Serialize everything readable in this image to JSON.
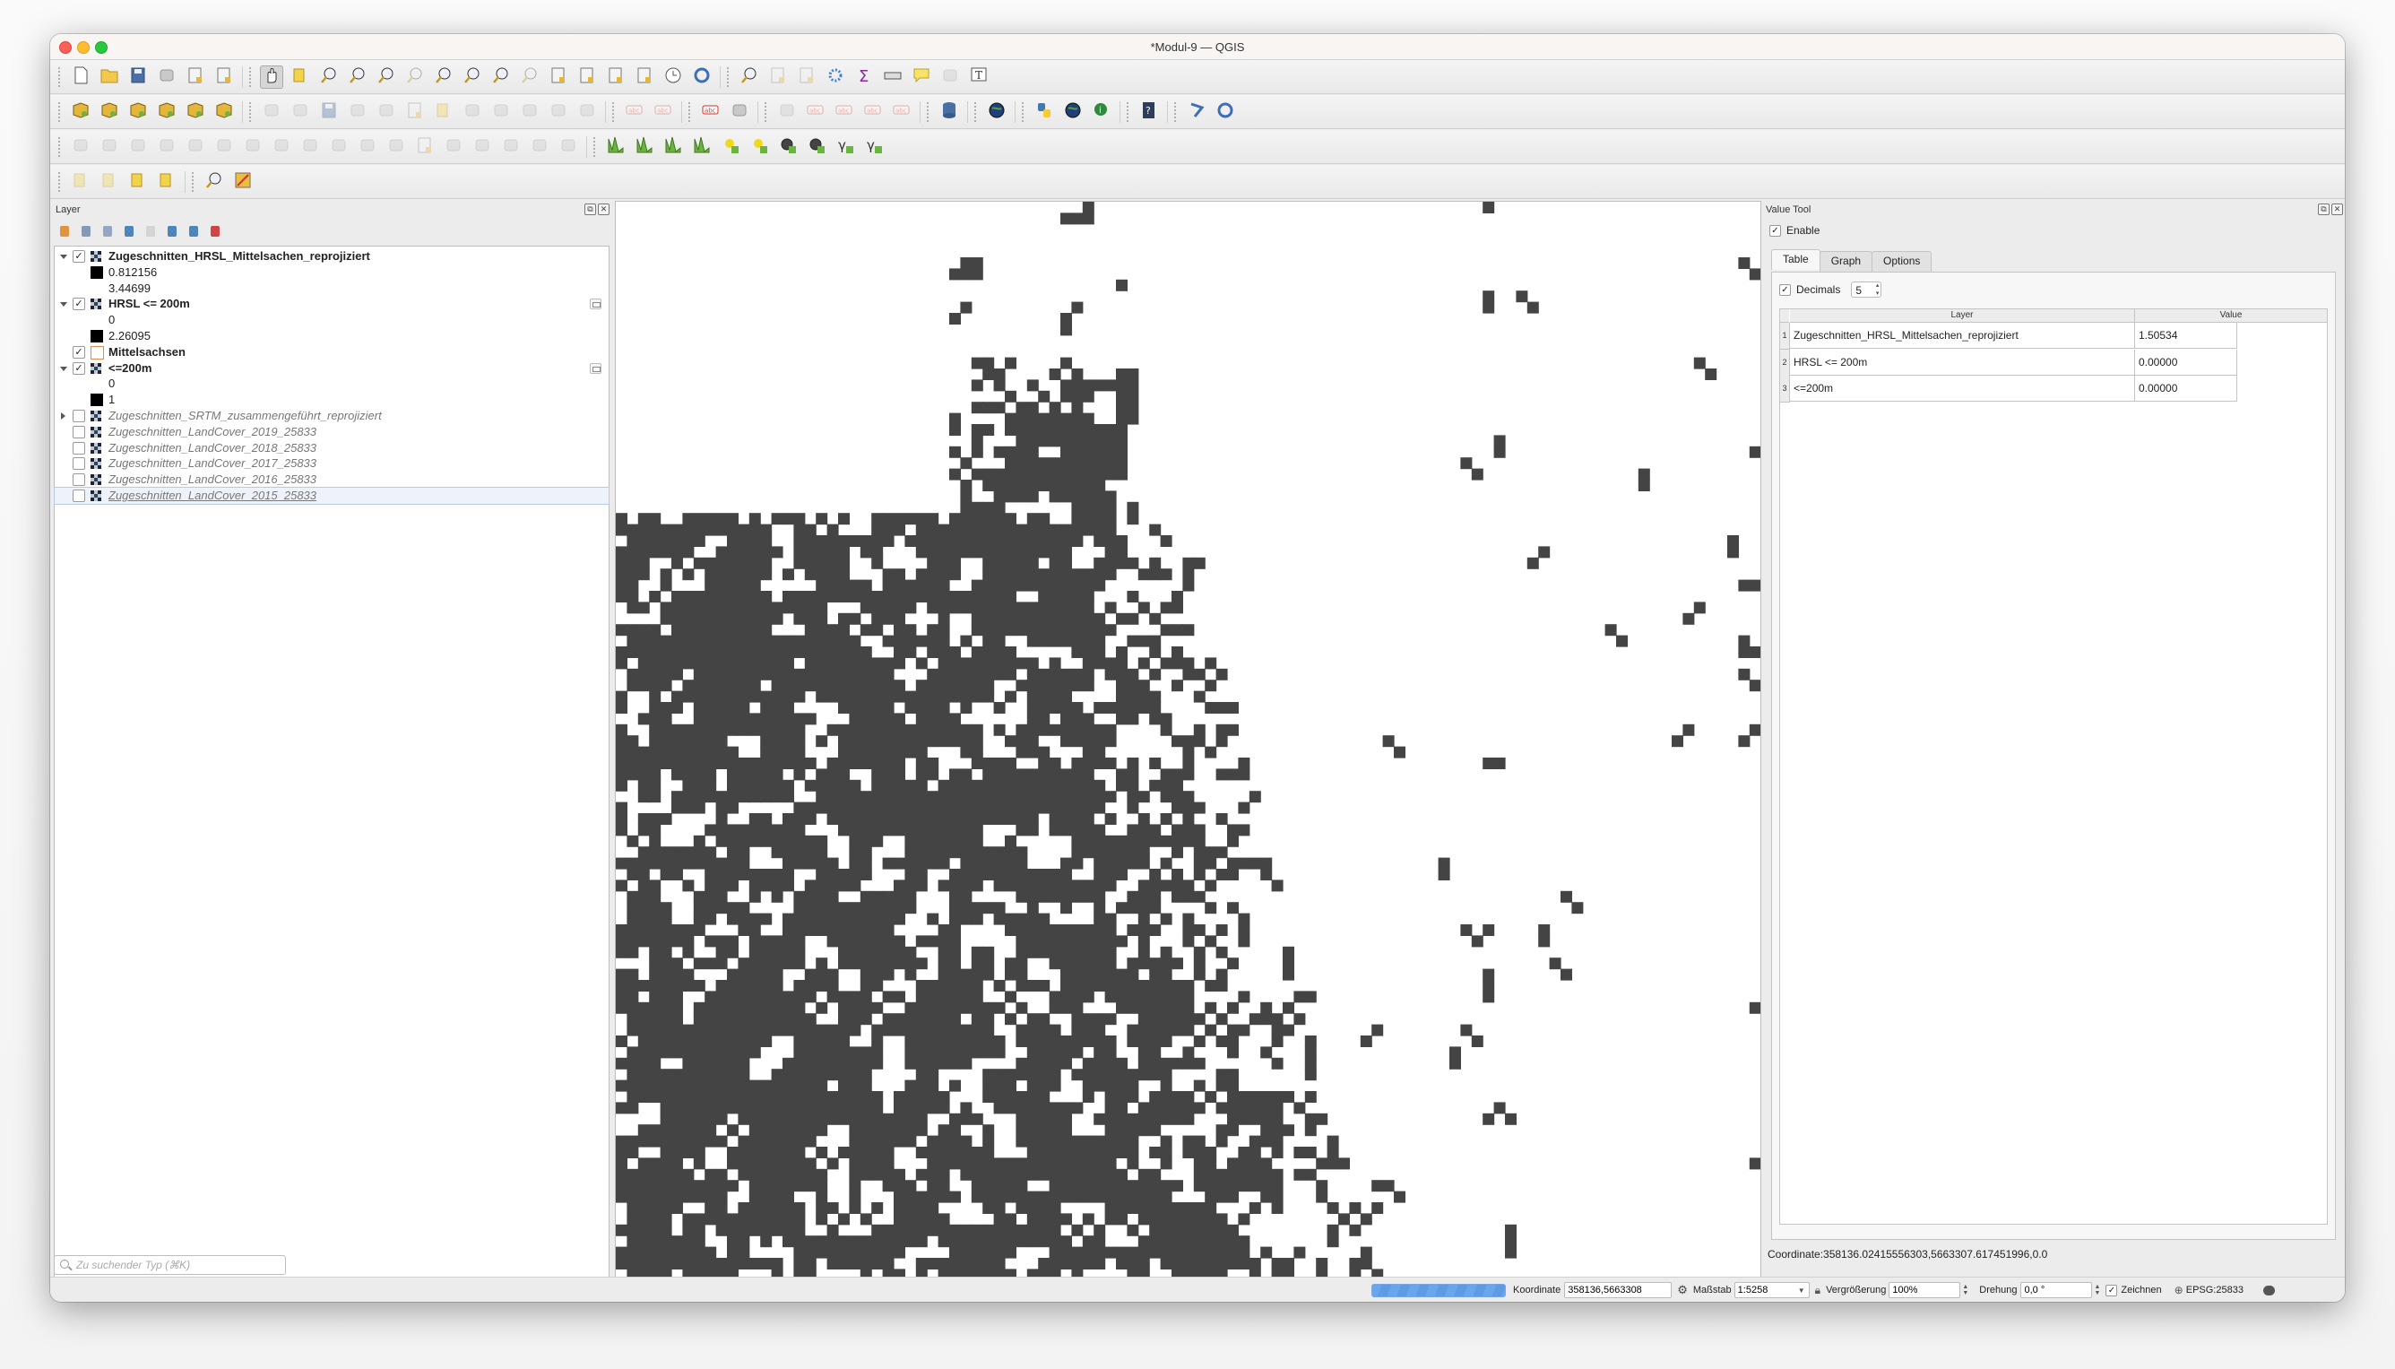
{
  "window": {
    "title": "*Modul-9 — QGIS"
  },
  "toolbars": {
    "row1": [
      "new-project-icon",
      "open-project-icon",
      "save-project-icon",
      "save-as-icon",
      "print-layout-icon",
      "style-manager-icon",
      "|",
      "pan-icon",
      "pan-to-selection-icon",
      "zoom-in-icon",
      "zoom-out-icon",
      "zoom-full-icon",
      "zoom-to-selection-icon",
      "zoom-to-layer-icon",
      "zoom-native-icon",
      "zoom-last-icon",
      "zoom-next-icon",
      "new-map-view-icon",
      "new-3d-view-icon",
      "new-bookmark-icon",
      "show-bookmarks-icon",
      "temporal-controller-icon",
      "refresh-icon",
      "|",
      "identify-icon",
      "open-attribute-table-icon",
      "statistics-icon",
      "toolbox-icon",
      "sum-icon",
      "measure-icon",
      "map-tips-icon",
      "annotation-icon",
      "text-annotation-icon"
    ],
    "row2": [
      "data-source-manager-icon",
      "new-geopackage-icon",
      "new-shapefile-icon",
      "new-spatialite-icon",
      "new-virtual-layer-icon",
      "new-temp-layer-icon",
      "|",
      "current-edits-icon",
      "toggle-editing-icon",
      "save-edits-icon",
      "add-feature-icon",
      "vertex-tool-icon",
      "modify-attributes-icon",
      "delete-selected-icon",
      "cut-icon",
      "copy-icon",
      "paste-icon",
      "undo-icon",
      "redo-icon",
      "|",
      "label-icon",
      "pin-labels-icon",
      "|",
      "layer-labeling-icon",
      "layer-diagram-icon",
      "|",
      "highlight-pinned-icon",
      "show-hide-labels-icon",
      "move-label-icon",
      "rotate-label-icon",
      "change-label-icon",
      "|",
      "db-manager-icon",
      "|",
      "metasearch-icon",
      "|",
      "python-console-icon",
      "globe-icon",
      "info-icon",
      "|",
      "help-icon",
      "|",
      "topology-checker-icon",
      "table-sync-icon"
    ],
    "row3": [
      "digitize-shape-icon",
      "measure-angle-icon",
      "add-ring-icon",
      "add-part-icon",
      "fill-ring-icon",
      "delete-ring-icon",
      "delete-part-icon",
      "reshape-icon",
      "offset-curve-icon",
      "split-features-icon",
      "split-parts-icon",
      "merge-features-icon",
      "merge-attributes-icon",
      "rotate-point-icon",
      "simplify-icon",
      "add-circular-icon",
      "trim-extend-icon",
      "reverse-line-icon",
      "|",
      "histogram-icon",
      "histogram-stretch-icon",
      "local-histogram-icon",
      "local-stretch-icon",
      "increase-brightness-icon",
      "decrease-brightness-icon",
      "increase-contrast-icon",
      "decrease-contrast-icon",
      "increase-gamma-icon",
      "decrease-gamma-icon"
    ],
    "row4": [
      "select-features-icon",
      "select-by-value-icon",
      "deselect-icon",
      "select-location-icon",
      "|",
      "locator-icon",
      "georeferencer-icon"
    ]
  },
  "layers_panel": {
    "title": "Layer",
    "tools": [
      "open-styling-icon",
      "add-group-icon",
      "manage-visibility-icon",
      "filter-legend-icon",
      "filter-expression-icon",
      "expand-all-icon",
      "collapse-all-icon",
      "remove-layer-icon"
    ],
    "items": [
      {
        "name": "Zugeschnitten_HRSL_Mittelsachen_reprojiziert",
        "checked": true,
        "expanded": true,
        "style": "bold",
        "type": "raster"
      },
      {
        "legend": "0.812156",
        "swatch": "black"
      },
      {
        "legend": "3.44699",
        "swatch": "none"
      },
      {
        "name": "HRSL <= 200m",
        "checked": true,
        "expanded": true,
        "style": "bold",
        "type": "raster",
        "memory": true
      },
      {
        "legend": "0",
        "swatch": "none"
      },
      {
        "legend": "2.26095",
        "swatch": "black"
      },
      {
        "name": "Mittelsachsen",
        "checked": true,
        "style": "bold",
        "type": "polygon"
      },
      {
        "name": "<=200m",
        "checked": true,
        "expanded": true,
        "style": "bold",
        "type": "raster",
        "memory": true
      },
      {
        "legend": "0",
        "swatch": "none"
      },
      {
        "legend": "1",
        "swatch": "black"
      },
      {
        "name": "Zugeschnitten_SRTM_zusammengeführt_reprojiziert",
        "checked": false,
        "expanded": false,
        "style": "italic",
        "type": "raster"
      },
      {
        "name": "Zugeschnitten_LandCover_2019_25833",
        "checked": false,
        "style": "italic",
        "type": "raster"
      },
      {
        "name": "Zugeschnitten_LandCover_2018_25833",
        "checked": false,
        "style": "italic",
        "type": "raster"
      },
      {
        "name": "Zugeschnitten_LandCover_2017_25833",
        "checked": false,
        "style": "italic",
        "type": "raster"
      },
      {
        "name": "Zugeschnitten_LandCover_2016_25833",
        "checked": false,
        "style": "italic",
        "type": "raster"
      },
      {
        "name": "Zugeschnitten_LandCover_2015_25833",
        "checked": false,
        "style": "italic",
        "type": "raster",
        "selected": true
      }
    ],
    "search_placeholder": "Zu suchender Typ (⌘K)"
  },
  "map": {
    "cell_color": "#444444",
    "background": "#ffffff"
  },
  "value_tool": {
    "title": "Value Tool",
    "enable_label": "Enable",
    "enable_checked": true,
    "tabs": [
      "Table",
      "Graph",
      "Options"
    ],
    "active_tab": "Table",
    "decimals_label": "Decimals",
    "decimals_checked": true,
    "decimals_value": "5",
    "columns": [
      "Layer",
      "Value"
    ],
    "rows": [
      {
        "n": "1",
        "layer": "Zugeschnitten_HRSL_Mittelsachen_reprojiziert",
        "value": "1.50534"
      },
      {
        "n": "2",
        "layer": "HRSL <= 200m",
        "value": "0.00000"
      },
      {
        "n": "3",
        "layer": "<=200m",
        "value": "0.00000"
      }
    ],
    "coordinate": "Coordinate:358136.02415556303,5663307.617451996,0.0"
  },
  "status_bar": {
    "progress_fraction": 1.0,
    "coordinate_label": "Koordinate",
    "coordinate_value": "358136,5663308",
    "scale_label": "Maßstab",
    "scale_value": "1:5258",
    "magnifier_label": "Vergrößerung",
    "magnifier_value": "100%",
    "rotation_label": "Drehung",
    "rotation_value": "0,0 °",
    "render_label": "Zeichnen",
    "render_checked": true,
    "crs": "EPSG:25833"
  }
}
